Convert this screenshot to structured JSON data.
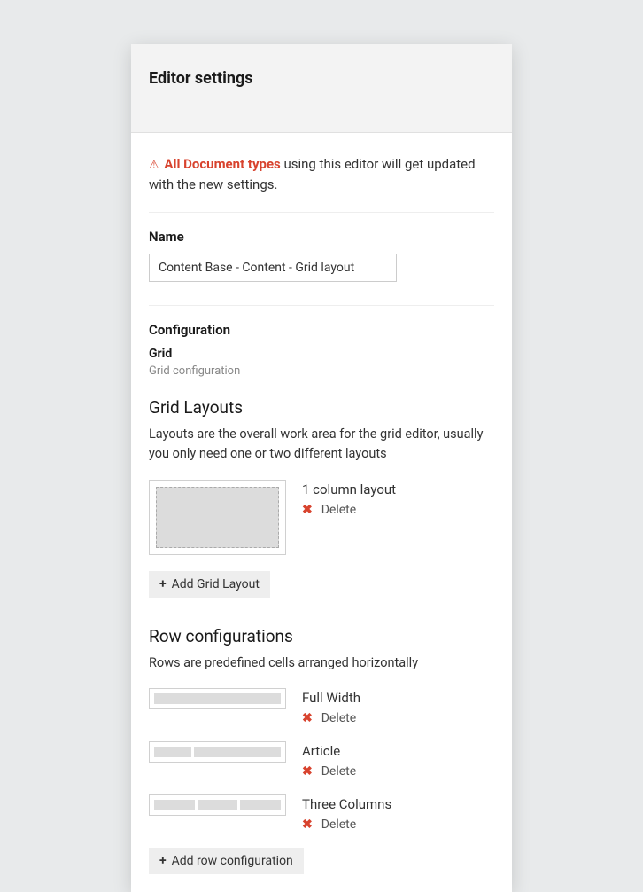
{
  "header": {
    "title": "Editor settings"
  },
  "warning": {
    "strong": "All Document types",
    "rest": " using this editor will get updated with the new settings."
  },
  "nameField": {
    "label": "Name",
    "value": "Content Base - Content - Grid layout"
  },
  "configuration": {
    "heading": "Configuration",
    "subheading": "Grid",
    "hint": "Grid configuration"
  },
  "gridLayouts": {
    "title": "Grid Layouts",
    "description": "Layouts are the overall work area for the grid editor, usually you only need one or two different layouts",
    "items": [
      {
        "name": "1 column layout",
        "deleteLabel": "Delete"
      }
    ],
    "addButton": "Add Grid Layout"
  },
  "rowConfigurations": {
    "title": "Row configurations",
    "description": "Rows are predefined cells arranged horizontally",
    "items": [
      {
        "name": "Full Width",
        "deleteLabel": "Delete"
      },
      {
        "name": "Article",
        "deleteLabel": "Delete"
      },
      {
        "name": "Three Columns",
        "deleteLabel": "Delete"
      }
    ],
    "addButton": "Add row configuration"
  }
}
